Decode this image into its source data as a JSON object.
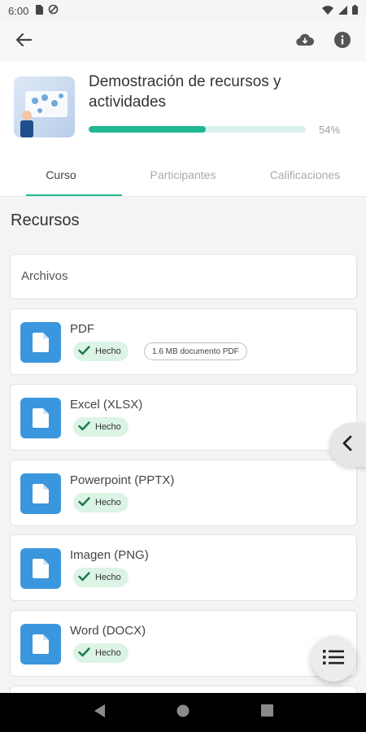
{
  "status_bar": {
    "time": "6:00"
  },
  "course": {
    "title": "Demostración de recursos y actividades",
    "progress_percent": 54,
    "progress_label": "54%"
  },
  "tabs": [
    {
      "label": "Curso",
      "active": true
    },
    {
      "label": "Participantes",
      "active": false
    },
    {
      "label": "Calificaciones",
      "active": false
    }
  ],
  "section": {
    "title": "Recursos",
    "subsection": "Archivos"
  },
  "resources": [
    {
      "name": "PDF",
      "status": "Hecho",
      "info": "1.6 MB documento PDF"
    },
    {
      "name": "Excel (XLSX)",
      "status": "Hecho"
    },
    {
      "name": "Powerpoint (PPTX)",
      "status": "Hecho"
    },
    {
      "name": "Imagen (PNG)",
      "status": "Hecho"
    },
    {
      "name": "Word (DOCX)",
      "status": "Hecho"
    }
  ],
  "colors": {
    "accent": "#1fb892",
    "file_icon": "#3b97dd",
    "badge_bg": "#dcf4e6"
  }
}
